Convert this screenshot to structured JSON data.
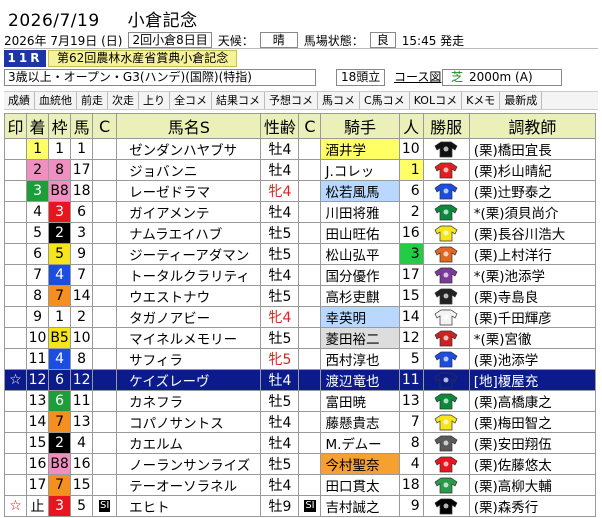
{
  "header": {
    "date": "2026/7/19",
    "race_title": "小倉記念"
  },
  "info": {
    "date_line": "2026年 7月19日 (日)",
    "kaisai": "2回小倉8日目",
    "weather_label": "天候：",
    "weather": "晴",
    "track_label": "馬場状態：",
    "track": "良",
    "post_time": "15:45 発走"
  },
  "race": {
    "number": "11R",
    "name": "第62回農林水産省賞典小倉記念",
    "conditions": "3歳以上・オープン・G3(ハンデ)(国際)(特指)",
    "field": "18頭立",
    "course_link": "コース図",
    "surface": "芝",
    "distance": "2000m (A)"
  },
  "tabs": [
    "成績",
    "血統他",
    "前走",
    "次走",
    "上り",
    "全コメ",
    "結果コメ",
    "予想コメ",
    "馬コメ",
    "C馬コメ",
    "KOLコメ",
    "Kメモ",
    "最新成"
  ],
  "table": {
    "headers": {
      "mark": "印",
      "finish": "着",
      "waku": "枠",
      "umaban": "馬",
      "c1": "C",
      "horse": "馬名S",
      "sexage": "性齢",
      "c2": "C",
      "jockey": "騎手",
      "ninki": "人",
      "silks": "勝服",
      "trainer": "調教師"
    },
    "rows": [
      {
        "mark": "",
        "finish": "1",
        "waku": "1",
        "umaban": "1",
        "horse": "ゼンダンハヤブサ",
        "sexage": "牡4",
        "jockey": "酒井学",
        "ninki": "10",
        "trainer": "(栗)橋田宜長"
      },
      {
        "mark": "",
        "finish": "2",
        "waku": "8",
        "umaban": "17",
        "horse": "ジョバンニ",
        "sexage": "牡4",
        "jockey": "J.コレッ",
        "ninki": "1",
        "trainer": "(栗)杉山晴紀"
      },
      {
        "mark": "",
        "finish": "3",
        "waku": "B8",
        "umaban": "18",
        "horse": "レーゼドラマ",
        "sexage": "牝4",
        "jockey": "松若風馬",
        "ninki": "6",
        "trainer": "(栗)辻野泰之"
      },
      {
        "mark": "",
        "finish": "4",
        "waku": "3",
        "umaban": "6",
        "horse": "ガイアメンテ",
        "sexage": "牡4",
        "jockey": "川田将雅",
        "ninki": "2",
        "trainer": "*(栗)須貝尚介"
      },
      {
        "mark": "",
        "finish": "5",
        "waku": "2",
        "umaban": "3",
        "horse": "ナムラエイハブ",
        "sexage": "牡5",
        "jockey": "田山旺佑",
        "ninki": "16",
        "trainer": "(栗)長谷川浩大"
      },
      {
        "mark": "",
        "finish": "6",
        "waku": "5",
        "umaban": "9",
        "horse": "ジーティーアダマン",
        "sexage": "牡5",
        "jockey": "松山弘平",
        "ninki": "3",
        "trainer": "(栗)上村洋行"
      },
      {
        "mark": "",
        "finish": "7",
        "waku": "4",
        "umaban": "7",
        "horse": "トータルクラリティ",
        "sexage": "牡4",
        "jockey": "国分優作",
        "ninki": "17",
        "trainer": "*(栗)池添学"
      },
      {
        "mark": "",
        "finish": "8",
        "waku": "7",
        "umaban": "14",
        "horse": "ウエストナウ",
        "sexage": "牡5",
        "jockey": "高杉吏麒",
        "ninki": "15",
        "trainer": "(栗)寺島良"
      },
      {
        "mark": "",
        "finish": "9",
        "waku": "1",
        "umaban": "2",
        "horse": "タガノアビー",
        "sexage": "牝4",
        "jockey": "幸英明",
        "ninki": "14",
        "trainer": "(栗)千田輝彦"
      },
      {
        "mark": "",
        "finish": "10",
        "waku": "B5",
        "umaban": "10",
        "horse": "マイネルメモリー",
        "sexage": "牡5",
        "jockey": "菱田裕二",
        "ninki": "12",
        "trainer": "*(栗)宮徹"
      },
      {
        "mark": "",
        "finish": "11",
        "waku": "4",
        "umaban": "8",
        "horse": "サフィラ",
        "sexage": "牝5",
        "jockey": "西村淳也",
        "ninki": "5",
        "trainer": "(栗)池添学"
      },
      {
        "mark": "☆",
        "finish": "12",
        "waku": "6",
        "umaban": "12",
        "horse": "ケイズレーヴ",
        "sexage": "牡4",
        "jockey": "渡辺竜也",
        "ninki": "11",
        "trainer": "[地]榎屋充"
      },
      {
        "mark": "",
        "finish": "13",
        "waku": "6",
        "umaban": "11",
        "horse": "カネフラ",
        "sexage": "牡5",
        "jockey": "富田暁",
        "ninki": "13",
        "trainer": "(栗)高橋康之"
      },
      {
        "mark": "",
        "finish": "14",
        "waku": "7",
        "umaban": "13",
        "horse": "コパノサントス",
        "sexage": "牡4",
        "jockey": "藤懸貴志",
        "ninki": "7",
        "trainer": "(栗)梅田智之"
      },
      {
        "mark": "",
        "finish": "15",
        "waku": "2",
        "umaban": "4",
        "horse": "カエルム",
        "sexage": "牡4",
        "jockey": "M.デムー",
        "ninki": "8",
        "trainer": "(栗)安田翔伍"
      },
      {
        "mark": "",
        "finish": "16",
        "waku": "B8",
        "umaban": "16",
        "horse": "ノーランサンライズ",
        "sexage": "牡5",
        "jockey": "今村聖奈",
        "ninki": "4",
        "trainer": "(栗)佐藤悠太"
      },
      {
        "mark": "",
        "finish": "17",
        "waku": "7",
        "umaban": "15",
        "horse": "テーオーソラネル",
        "sexage": "牡4",
        "jockey": "田口貫太",
        "ninki": "18",
        "trainer": "(栗)高柳大輔"
      },
      {
        "mark": "☆",
        "finish": "止",
        "waku": "3",
        "umaban": "5",
        "horse": "エヒト",
        "sexage": "牡9",
        "jockey": "吉村誠之",
        "ninki": "9",
        "trainer": "(栗)森秀行"
      }
    ]
  },
  "colors": {
    "header_bg": "#eaf0b8",
    "highlight_row": "#0b1b8c",
    "race_number_bg": "#1c36a8",
    "race_name_bg": "#f6f29a"
  }
}
